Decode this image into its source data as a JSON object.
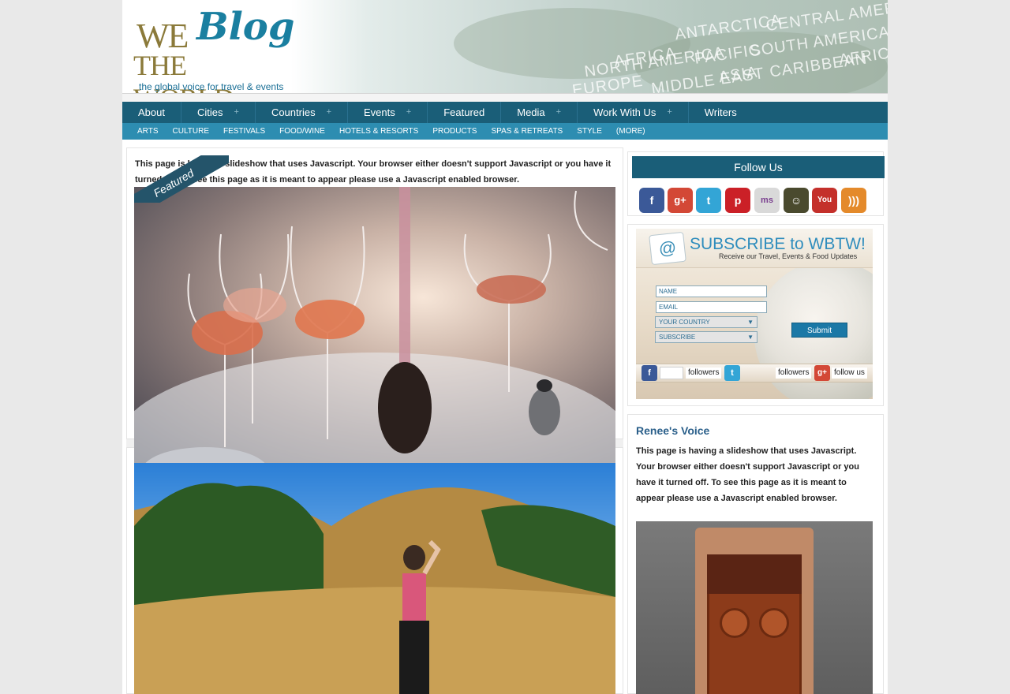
{
  "site": {
    "logo_we": "WE",
    "logo_blog": "Blog",
    "logo_world": "THE WORLD",
    "tagline": "the global voice for travel & events",
    "regions": [
      "AFRICA",
      "ANTARCTICA",
      "CENTRAL AMERICA",
      "NORTH AMERICA",
      "PACIFIC",
      "SOUTH AMERICA",
      "EUROPE",
      "MIDDLE EAST",
      "ASIA",
      "CARIBBEAN",
      "AFRICA"
    ]
  },
  "nav": {
    "items": [
      {
        "label": "About"
      },
      {
        "label": "Cities"
      },
      {
        "label": "Countries"
      },
      {
        "label": "Events"
      },
      {
        "label": "Featured"
      },
      {
        "label": "Media"
      },
      {
        "label": "Work With Us"
      },
      {
        "label": "Writers"
      }
    ],
    "sub_items": [
      {
        "label": "ARTS"
      },
      {
        "label": "CULTURE"
      },
      {
        "label": "FESTIVALS"
      },
      {
        "label": "FOOD/WINE"
      },
      {
        "label": "HOTELS & RESORTS"
      },
      {
        "label": "PRODUCTS"
      },
      {
        "label": "SPAS & RETREATS"
      },
      {
        "label": "STYLE"
      },
      {
        "label": "(MORE)"
      }
    ]
  },
  "featured": {
    "ribbon": "Featured",
    "js_notice": "This page is having a slideshow that uses Javascript. Your browser either doesn't support Javascript or you have it turned off. To see this page as it is meant to appear please use a Javascript enabled browser."
  },
  "sidebar": {
    "follow_title": "Follow Us",
    "social": [
      {
        "icon": "facebook-icon",
        "glyph": "f",
        "color": "#3b5998"
      },
      {
        "icon": "google-plus-icon",
        "glyph": "g+",
        "color": "#d34836"
      },
      {
        "icon": "twitter-icon",
        "glyph": "t",
        "color": "#33a5d6"
      },
      {
        "icon": "pinterest-icon",
        "glyph": "p",
        "color": "#cb2027"
      },
      {
        "icon": "ms-photo-icon",
        "glyph": "ms",
        "color": "#bbbbbb"
      },
      {
        "icon": "stumble-icon",
        "glyph": "☺",
        "color": "#4a4a2e"
      },
      {
        "icon": "youtube-icon",
        "glyph": "You",
        "color": "#c4302b"
      },
      {
        "icon": "rss-icon",
        "glyph": ")",
        "color": "#e48a2b"
      }
    ],
    "subscribe": {
      "headline": "SUBSCRIBE to WBTW!",
      "subline": "Receive our Travel, Events & Food Updates",
      "name_placeholder": "NAME",
      "email_placeholder": "EMAIL",
      "country_label": "YOUR COUNTRY",
      "subscribe_label": "SUBSCRIBE",
      "submit_label": "Submit",
      "followers_label": "followers",
      "follow_us_label": "follow us"
    },
    "voice": {
      "title": "Renee's Voice",
      "text": "This page is having a slideshow that uses Javascript. Your browser either doesn't support Javascript or you have it turned off. To see this page as it is meant to appear please use a Javascript enabled browser."
    }
  }
}
